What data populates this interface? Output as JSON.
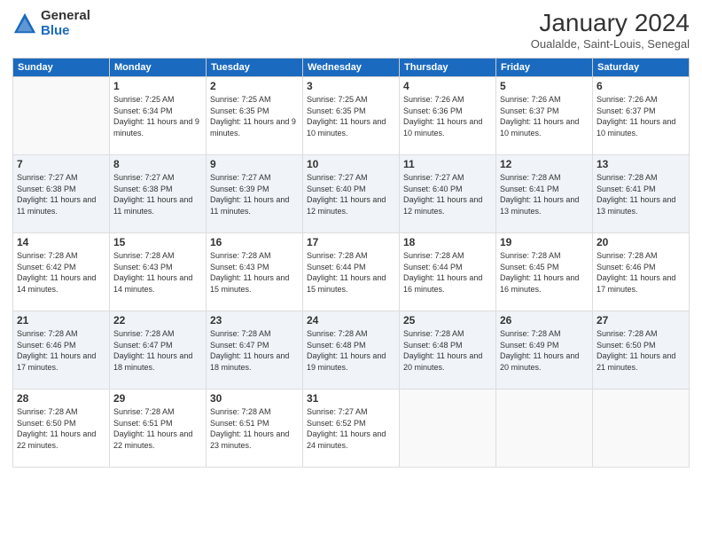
{
  "header": {
    "logo_general": "General",
    "logo_blue": "Blue",
    "month_year": "January 2024",
    "location": "Oualalde, Saint-Louis, Senegal"
  },
  "days_of_week": [
    "Sunday",
    "Monday",
    "Tuesday",
    "Wednesday",
    "Thursday",
    "Friday",
    "Saturday"
  ],
  "weeks": [
    [
      {
        "day": "",
        "sunrise": "",
        "sunset": "",
        "daylight": ""
      },
      {
        "day": "1",
        "sunrise": "Sunrise: 7:25 AM",
        "sunset": "Sunset: 6:34 PM",
        "daylight": "Daylight: 11 hours and 9 minutes."
      },
      {
        "day": "2",
        "sunrise": "Sunrise: 7:25 AM",
        "sunset": "Sunset: 6:35 PM",
        "daylight": "Daylight: 11 hours and 9 minutes."
      },
      {
        "day": "3",
        "sunrise": "Sunrise: 7:25 AM",
        "sunset": "Sunset: 6:35 PM",
        "daylight": "Daylight: 11 hours and 10 minutes."
      },
      {
        "day": "4",
        "sunrise": "Sunrise: 7:26 AM",
        "sunset": "Sunset: 6:36 PM",
        "daylight": "Daylight: 11 hours and 10 minutes."
      },
      {
        "day": "5",
        "sunrise": "Sunrise: 7:26 AM",
        "sunset": "Sunset: 6:37 PM",
        "daylight": "Daylight: 11 hours and 10 minutes."
      },
      {
        "day": "6",
        "sunrise": "Sunrise: 7:26 AM",
        "sunset": "Sunset: 6:37 PM",
        "daylight": "Daylight: 11 hours and 10 minutes."
      }
    ],
    [
      {
        "day": "7",
        "sunrise": "Sunrise: 7:27 AM",
        "sunset": "Sunset: 6:38 PM",
        "daylight": "Daylight: 11 hours and 11 minutes."
      },
      {
        "day": "8",
        "sunrise": "Sunrise: 7:27 AM",
        "sunset": "Sunset: 6:38 PM",
        "daylight": "Daylight: 11 hours and 11 minutes."
      },
      {
        "day": "9",
        "sunrise": "Sunrise: 7:27 AM",
        "sunset": "Sunset: 6:39 PM",
        "daylight": "Daylight: 11 hours and 11 minutes."
      },
      {
        "day": "10",
        "sunrise": "Sunrise: 7:27 AM",
        "sunset": "Sunset: 6:40 PM",
        "daylight": "Daylight: 11 hours and 12 minutes."
      },
      {
        "day": "11",
        "sunrise": "Sunrise: 7:27 AM",
        "sunset": "Sunset: 6:40 PM",
        "daylight": "Daylight: 11 hours and 12 minutes."
      },
      {
        "day": "12",
        "sunrise": "Sunrise: 7:28 AM",
        "sunset": "Sunset: 6:41 PM",
        "daylight": "Daylight: 11 hours and 13 minutes."
      },
      {
        "day": "13",
        "sunrise": "Sunrise: 7:28 AM",
        "sunset": "Sunset: 6:41 PM",
        "daylight": "Daylight: 11 hours and 13 minutes."
      }
    ],
    [
      {
        "day": "14",
        "sunrise": "Sunrise: 7:28 AM",
        "sunset": "Sunset: 6:42 PM",
        "daylight": "Daylight: 11 hours and 14 minutes."
      },
      {
        "day": "15",
        "sunrise": "Sunrise: 7:28 AM",
        "sunset": "Sunset: 6:43 PM",
        "daylight": "Daylight: 11 hours and 14 minutes."
      },
      {
        "day": "16",
        "sunrise": "Sunrise: 7:28 AM",
        "sunset": "Sunset: 6:43 PM",
        "daylight": "Daylight: 11 hours and 15 minutes."
      },
      {
        "day": "17",
        "sunrise": "Sunrise: 7:28 AM",
        "sunset": "Sunset: 6:44 PM",
        "daylight": "Daylight: 11 hours and 15 minutes."
      },
      {
        "day": "18",
        "sunrise": "Sunrise: 7:28 AM",
        "sunset": "Sunset: 6:44 PM",
        "daylight": "Daylight: 11 hours and 16 minutes."
      },
      {
        "day": "19",
        "sunrise": "Sunrise: 7:28 AM",
        "sunset": "Sunset: 6:45 PM",
        "daylight": "Daylight: 11 hours and 16 minutes."
      },
      {
        "day": "20",
        "sunrise": "Sunrise: 7:28 AM",
        "sunset": "Sunset: 6:46 PM",
        "daylight": "Daylight: 11 hours and 17 minutes."
      }
    ],
    [
      {
        "day": "21",
        "sunrise": "Sunrise: 7:28 AM",
        "sunset": "Sunset: 6:46 PM",
        "daylight": "Daylight: 11 hours and 17 minutes."
      },
      {
        "day": "22",
        "sunrise": "Sunrise: 7:28 AM",
        "sunset": "Sunset: 6:47 PM",
        "daylight": "Daylight: 11 hours and 18 minutes."
      },
      {
        "day": "23",
        "sunrise": "Sunrise: 7:28 AM",
        "sunset": "Sunset: 6:47 PM",
        "daylight": "Daylight: 11 hours and 18 minutes."
      },
      {
        "day": "24",
        "sunrise": "Sunrise: 7:28 AM",
        "sunset": "Sunset: 6:48 PM",
        "daylight": "Daylight: 11 hours and 19 minutes."
      },
      {
        "day": "25",
        "sunrise": "Sunrise: 7:28 AM",
        "sunset": "Sunset: 6:48 PM",
        "daylight": "Daylight: 11 hours and 20 minutes."
      },
      {
        "day": "26",
        "sunrise": "Sunrise: 7:28 AM",
        "sunset": "Sunset: 6:49 PM",
        "daylight": "Daylight: 11 hours and 20 minutes."
      },
      {
        "day": "27",
        "sunrise": "Sunrise: 7:28 AM",
        "sunset": "Sunset: 6:50 PM",
        "daylight": "Daylight: 11 hours and 21 minutes."
      }
    ],
    [
      {
        "day": "28",
        "sunrise": "Sunrise: 7:28 AM",
        "sunset": "Sunset: 6:50 PM",
        "daylight": "Daylight: 11 hours and 22 minutes."
      },
      {
        "day": "29",
        "sunrise": "Sunrise: 7:28 AM",
        "sunset": "Sunset: 6:51 PM",
        "daylight": "Daylight: 11 hours and 22 minutes."
      },
      {
        "day": "30",
        "sunrise": "Sunrise: 7:28 AM",
        "sunset": "Sunset: 6:51 PM",
        "daylight": "Daylight: 11 hours and 23 minutes."
      },
      {
        "day": "31",
        "sunrise": "Sunrise: 7:27 AM",
        "sunset": "Sunset: 6:52 PM",
        "daylight": "Daylight: 11 hours and 24 minutes."
      },
      {
        "day": "",
        "sunrise": "",
        "sunset": "",
        "daylight": ""
      },
      {
        "day": "",
        "sunrise": "",
        "sunset": "",
        "daylight": ""
      },
      {
        "day": "",
        "sunrise": "",
        "sunset": "",
        "daylight": ""
      }
    ]
  ],
  "shaded_rows": [
    1,
    3
  ]
}
